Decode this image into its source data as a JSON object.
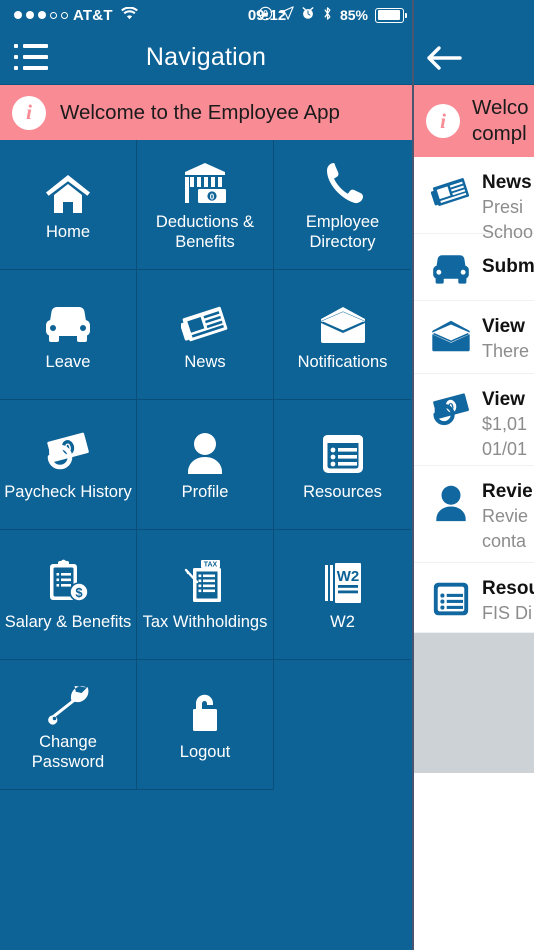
{
  "statusbar": {
    "carrier": "AT&T",
    "signal_dots_filled": 3,
    "signal_dots_total": 5,
    "wifi_icon": "wifi-icon",
    "time": "09:12",
    "rotation_lock_icon": "rotation-lock-icon",
    "location_icon": "location-arrow-icon",
    "alarm_icon": "alarm-clock-icon",
    "bluetooth_icon": "bluetooth-icon",
    "battery_percent": "85%",
    "battery_level": 85
  },
  "navbar": {
    "menu_icon": "hamburger-list-icon",
    "title": "Navigation"
  },
  "banner": {
    "icon": "info-icon",
    "text": "Welcome to the Employee App"
  },
  "grid": {
    "tiles": [
      {
        "label": "Home",
        "icon": "home-icon"
      },
      {
        "label": "Deductions & Benefits",
        "icon": "bank-money-icon"
      },
      {
        "label": "Employee Directory",
        "icon": "phone-icon"
      },
      {
        "label": "Leave",
        "icon": "car-icon"
      },
      {
        "label": "News",
        "icon": "newspaper-icon"
      },
      {
        "label": "Notifications",
        "icon": "envelope-icon"
      },
      {
        "label": "Paycheck History",
        "icon": "dollar-bill-icon"
      },
      {
        "label": "Profile",
        "icon": "person-icon"
      },
      {
        "label": "Resources",
        "icon": "list-card-icon"
      },
      {
        "label": "Salary & Benefits",
        "icon": "clipboard-dollar-icon"
      },
      {
        "label": "Tax Withholdings",
        "icon": "tax-form-icon"
      },
      {
        "label": "W2",
        "icon": "w2-document-icon"
      },
      {
        "label": "Change Password",
        "icon": "wrench-icon"
      },
      {
        "label": "Logout",
        "icon": "unlock-icon"
      },
      {
        "label": "",
        "icon": ""
      }
    ]
  },
  "right_panel": {
    "back_icon": "back-arrow-icon",
    "banner": {
      "icon": "info-icon",
      "line1": "Welco",
      "line2": "compl"
    },
    "items": [
      {
        "icon": "newspaper-icon",
        "title": "News",
        "sub1": "Presi",
        "sub2": "Schoo"
      },
      {
        "icon": "car-icon",
        "title": "Subm",
        "sub1": "",
        "sub2": ""
      },
      {
        "icon": "envelope-icon",
        "title": "View ",
        "sub1": "There",
        "sub2": ""
      },
      {
        "icon": "dollar-bill-icon",
        "title": "View ",
        "sub1": "$1,01",
        "sub2": "01/01"
      },
      {
        "icon": "person-icon",
        "title": "Revie",
        "sub1": "Revie",
        "sub2": "conta"
      },
      {
        "icon": "list-card-icon",
        "title": "Resou",
        "sub1": "FIS Di",
        "sub2": ""
      }
    ]
  },
  "colors": {
    "brand_blue": "#0d6296",
    "banner_pink": "#f98b95",
    "tile_border": "#0a4f79",
    "icon_blue": "#1167a0",
    "footer_gray": "#cdd2d6"
  }
}
